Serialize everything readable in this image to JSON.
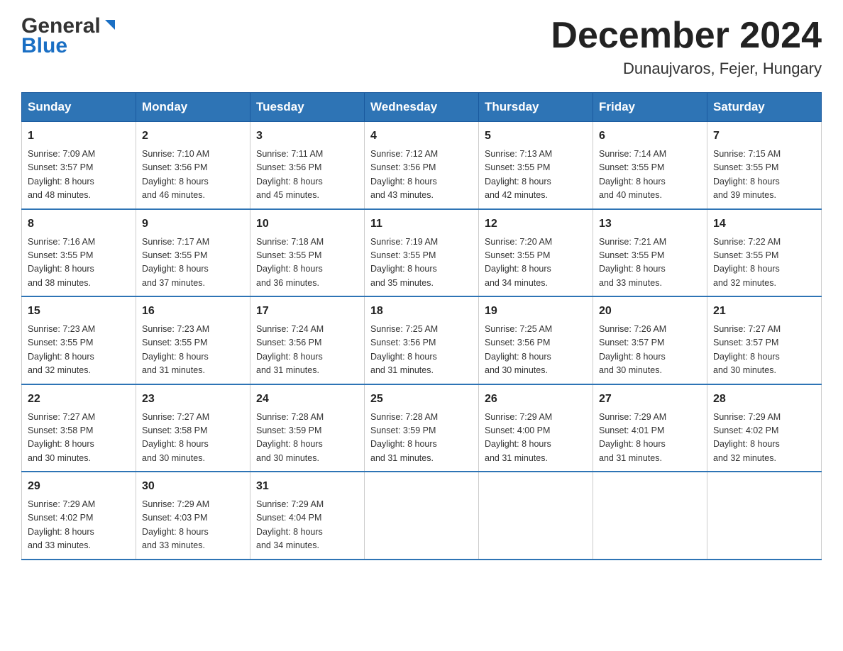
{
  "header": {
    "logo_general": "General",
    "logo_blue": "Blue",
    "title": "December 2024",
    "subtitle": "Dunaujvaros, Fejer, Hungary"
  },
  "days_of_week": [
    "Sunday",
    "Monday",
    "Tuesday",
    "Wednesday",
    "Thursday",
    "Friday",
    "Saturday"
  ],
  "weeks": [
    [
      {
        "day": "1",
        "sunrise": "7:09 AM",
        "sunset": "3:57 PM",
        "daylight": "8 hours and 48 minutes."
      },
      {
        "day": "2",
        "sunrise": "7:10 AM",
        "sunset": "3:56 PM",
        "daylight": "8 hours and 46 minutes."
      },
      {
        "day": "3",
        "sunrise": "7:11 AM",
        "sunset": "3:56 PM",
        "daylight": "8 hours and 45 minutes."
      },
      {
        "day": "4",
        "sunrise": "7:12 AM",
        "sunset": "3:56 PM",
        "daylight": "8 hours and 43 minutes."
      },
      {
        "day": "5",
        "sunrise": "7:13 AM",
        "sunset": "3:55 PM",
        "daylight": "8 hours and 42 minutes."
      },
      {
        "day": "6",
        "sunrise": "7:14 AM",
        "sunset": "3:55 PM",
        "daylight": "8 hours and 40 minutes."
      },
      {
        "day": "7",
        "sunrise": "7:15 AM",
        "sunset": "3:55 PM",
        "daylight": "8 hours and 39 minutes."
      }
    ],
    [
      {
        "day": "8",
        "sunrise": "7:16 AM",
        "sunset": "3:55 PM",
        "daylight": "8 hours and 38 minutes."
      },
      {
        "day": "9",
        "sunrise": "7:17 AM",
        "sunset": "3:55 PM",
        "daylight": "8 hours and 37 minutes."
      },
      {
        "day": "10",
        "sunrise": "7:18 AM",
        "sunset": "3:55 PM",
        "daylight": "8 hours and 36 minutes."
      },
      {
        "day": "11",
        "sunrise": "7:19 AM",
        "sunset": "3:55 PM",
        "daylight": "8 hours and 35 minutes."
      },
      {
        "day": "12",
        "sunrise": "7:20 AM",
        "sunset": "3:55 PM",
        "daylight": "8 hours and 34 minutes."
      },
      {
        "day": "13",
        "sunrise": "7:21 AM",
        "sunset": "3:55 PM",
        "daylight": "8 hours and 33 minutes."
      },
      {
        "day": "14",
        "sunrise": "7:22 AM",
        "sunset": "3:55 PM",
        "daylight": "8 hours and 32 minutes."
      }
    ],
    [
      {
        "day": "15",
        "sunrise": "7:23 AM",
        "sunset": "3:55 PM",
        "daylight": "8 hours and 32 minutes."
      },
      {
        "day": "16",
        "sunrise": "7:23 AM",
        "sunset": "3:55 PM",
        "daylight": "8 hours and 31 minutes."
      },
      {
        "day": "17",
        "sunrise": "7:24 AM",
        "sunset": "3:56 PM",
        "daylight": "8 hours and 31 minutes."
      },
      {
        "day": "18",
        "sunrise": "7:25 AM",
        "sunset": "3:56 PM",
        "daylight": "8 hours and 31 minutes."
      },
      {
        "day": "19",
        "sunrise": "7:25 AM",
        "sunset": "3:56 PM",
        "daylight": "8 hours and 30 minutes."
      },
      {
        "day": "20",
        "sunrise": "7:26 AM",
        "sunset": "3:57 PM",
        "daylight": "8 hours and 30 minutes."
      },
      {
        "day": "21",
        "sunrise": "7:27 AM",
        "sunset": "3:57 PM",
        "daylight": "8 hours and 30 minutes."
      }
    ],
    [
      {
        "day": "22",
        "sunrise": "7:27 AM",
        "sunset": "3:58 PM",
        "daylight": "8 hours and 30 minutes."
      },
      {
        "day": "23",
        "sunrise": "7:27 AM",
        "sunset": "3:58 PM",
        "daylight": "8 hours and 30 minutes."
      },
      {
        "day": "24",
        "sunrise": "7:28 AM",
        "sunset": "3:59 PM",
        "daylight": "8 hours and 30 minutes."
      },
      {
        "day": "25",
        "sunrise": "7:28 AM",
        "sunset": "3:59 PM",
        "daylight": "8 hours and 31 minutes."
      },
      {
        "day": "26",
        "sunrise": "7:29 AM",
        "sunset": "4:00 PM",
        "daylight": "8 hours and 31 minutes."
      },
      {
        "day": "27",
        "sunrise": "7:29 AM",
        "sunset": "4:01 PM",
        "daylight": "8 hours and 31 minutes."
      },
      {
        "day": "28",
        "sunrise": "7:29 AM",
        "sunset": "4:02 PM",
        "daylight": "8 hours and 32 minutes."
      }
    ],
    [
      {
        "day": "29",
        "sunrise": "7:29 AM",
        "sunset": "4:02 PM",
        "daylight": "8 hours and 33 minutes."
      },
      {
        "day": "30",
        "sunrise": "7:29 AM",
        "sunset": "4:03 PM",
        "daylight": "8 hours and 33 minutes."
      },
      {
        "day": "31",
        "sunrise": "7:29 AM",
        "sunset": "4:04 PM",
        "daylight": "8 hours and 34 minutes."
      },
      null,
      null,
      null,
      null
    ]
  ]
}
